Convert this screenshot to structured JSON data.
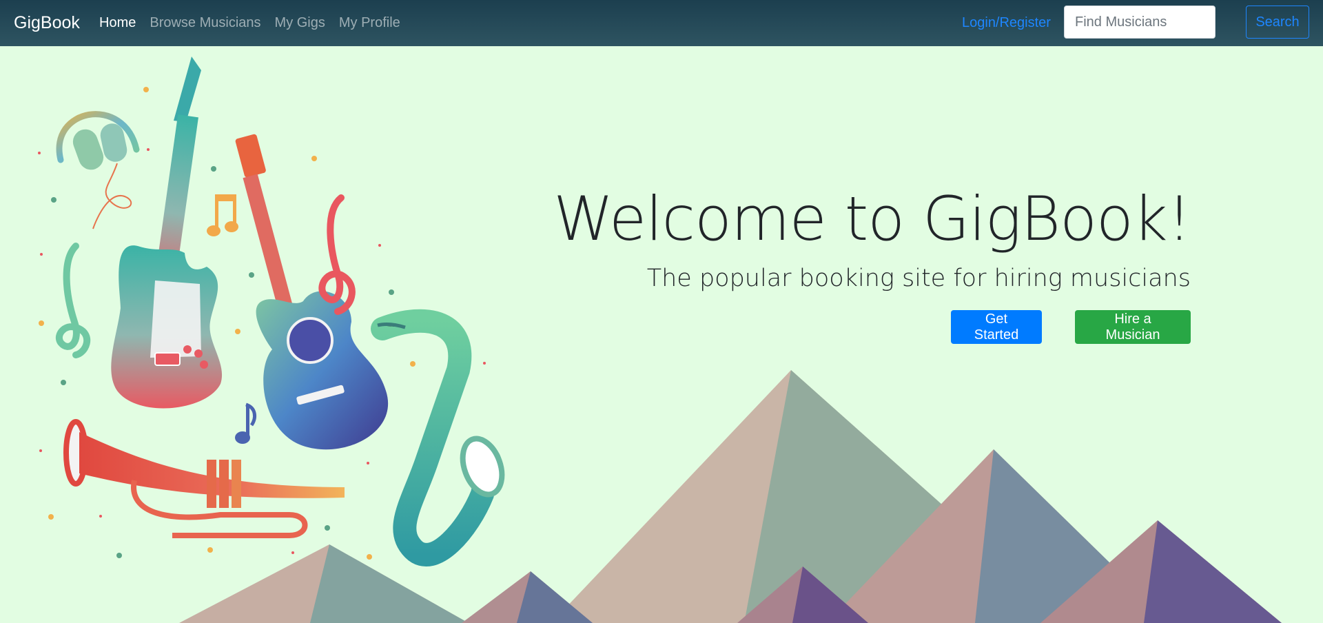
{
  "navbar": {
    "brand": "GigBook",
    "links": [
      {
        "label": "Home",
        "active": true
      },
      {
        "label": "Browse Musicians",
        "active": false
      },
      {
        "label": "My Gigs",
        "active": false
      },
      {
        "label": "My Profile",
        "active": false
      }
    ],
    "login_label": "Login/Register",
    "search_placeholder": "Find Musicians",
    "search_button": "Search"
  },
  "hero": {
    "title": "Welcome to GigBook!",
    "subtitle": "The popular booking site for hiring musicians",
    "primary_button": "Get Started",
    "secondary_button": "Hire a Musician"
  },
  "colors": {
    "navbar": "#1c3f4f",
    "background": "#e2fde2",
    "primary": "#007bff",
    "success": "#28a745",
    "link": "#1e86ff"
  },
  "icons": [
    "headphones-icon",
    "electric-guitar-icon",
    "acoustic-guitar-icon",
    "treble-clef-icon",
    "music-note-icon",
    "trumpet-icon",
    "saxophone-icon"
  ]
}
